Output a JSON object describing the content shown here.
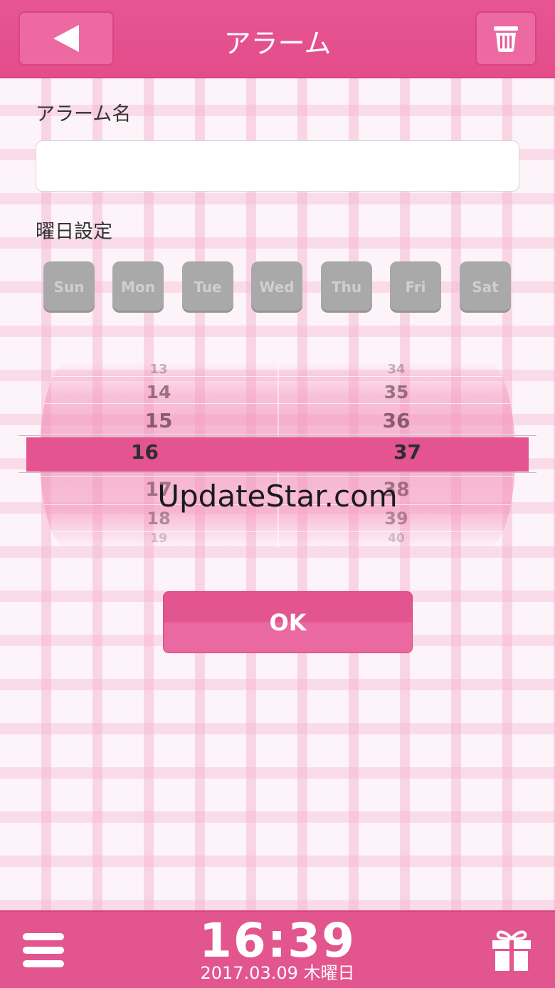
{
  "header": {
    "title": "アラーム"
  },
  "form": {
    "name_label": "アラーム名",
    "name_value": "",
    "days_label": "曜日設定",
    "days": [
      "Sun",
      "Mon",
      "Tue",
      "Wed",
      "Thu",
      "Fri",
      "Sat"
    ]
  },
  "picker": {
    "hours": [
      "13",
      "14",
      "15",
      "16",
      "17",
      "18",
      "19"
    ],
    "minutes": [
      "34",
      "35",
      "36",
      "37",
      "38",
      "39",
      "40"
    ],
    "selected_hour": "16",
    "selected_minute": "37"
  },
  "watermark": "UpdateStar.com",
  "ok_label": "OK",
  "footer": {
    "time": "16:39",
    "date": "2017.03.09 木曜日"
  },
  "colors": {
    "accent": "#e3558f",
    "day_button": "#a9a9a9"
  },
  "icons": {
    "back": "back-arrow-icon",
    "trash": "trash-icon",
    "menu": "menu-icon",
    "gift": "gift-icon"
  }
}
